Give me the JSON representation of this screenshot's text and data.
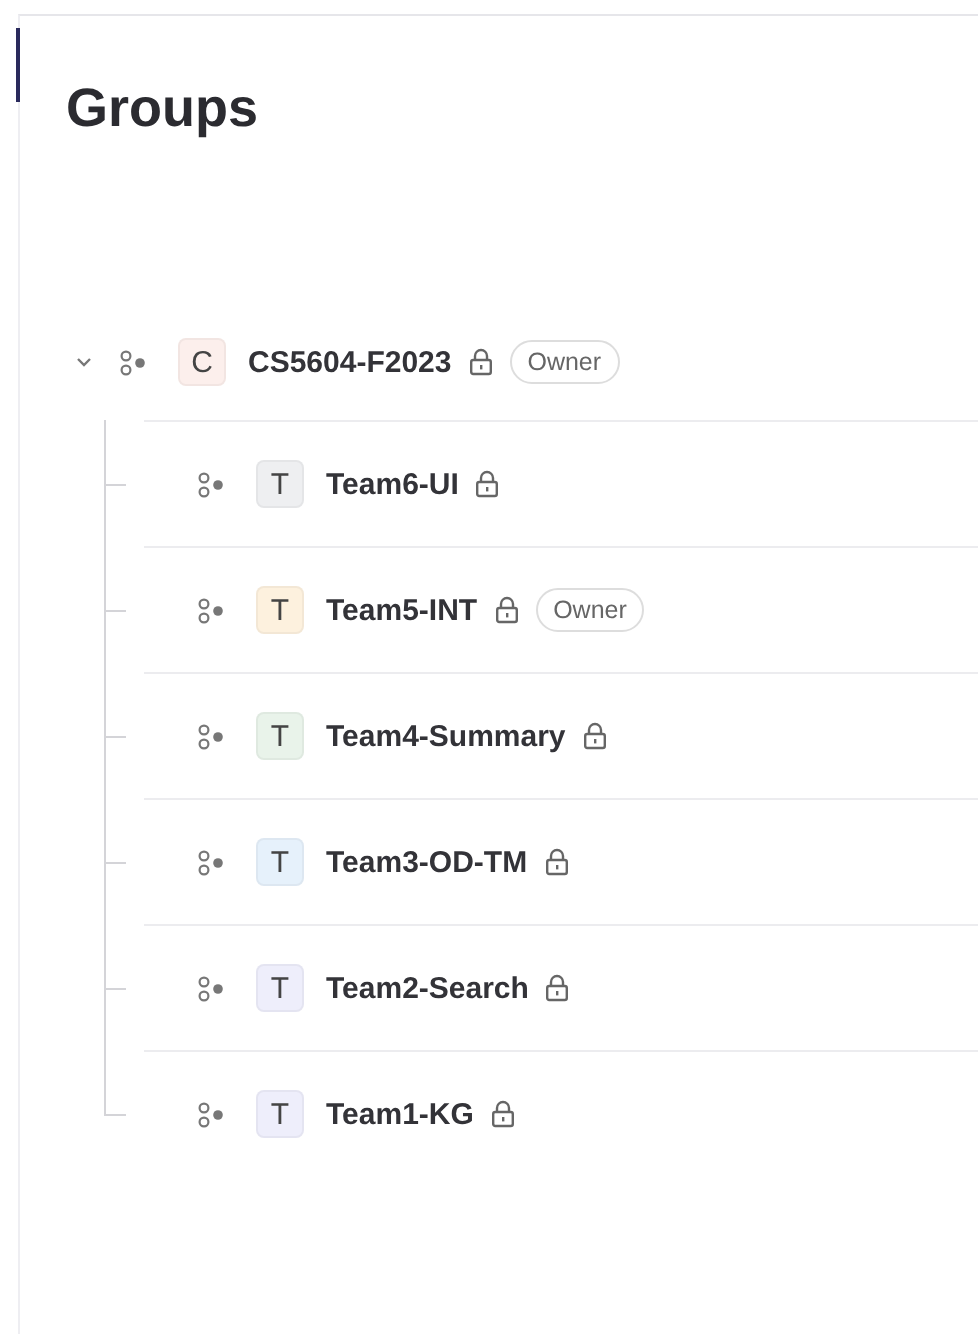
{
  "page": {
    "title": "Groups"
  },
  "tree": [
    {
      "initial": "C",
      "name": "CS5604-F2023",
      "color": "#fcefec",
      "locked": true,
      "badge": "Owner",
      "expanded": true,
      "children": [
        {
          "initial": "T",
          "name": "Team6-UI",
          "color": "#eeeff1",
          "locked": true
        },
        {
          "initial": "T",
          "name": "Team5-INT",
          "color": "#fdf1de",
          "locked": true,
          "badge": "Owner"
        },
        {
          "initial": "T",
          "name": "Team4-Summary",
          "color": "#e9f3ea",
          "locked": true
        },
        {
          "initial": "T",
          "name": "Team3-OD-TM",
          "color": "#e6f1fb",
          "locked": true
        },
        {
          "initial": "T",
          "name": "Team2-Search",
          "color": "#eeeefb",
          "locked": true
        },
        {
          "initial": "T",
          "name": "Team1-KG",
          "color": "#eeeefb",
          "locked": true
        }
      ]
    }
  ]
}
